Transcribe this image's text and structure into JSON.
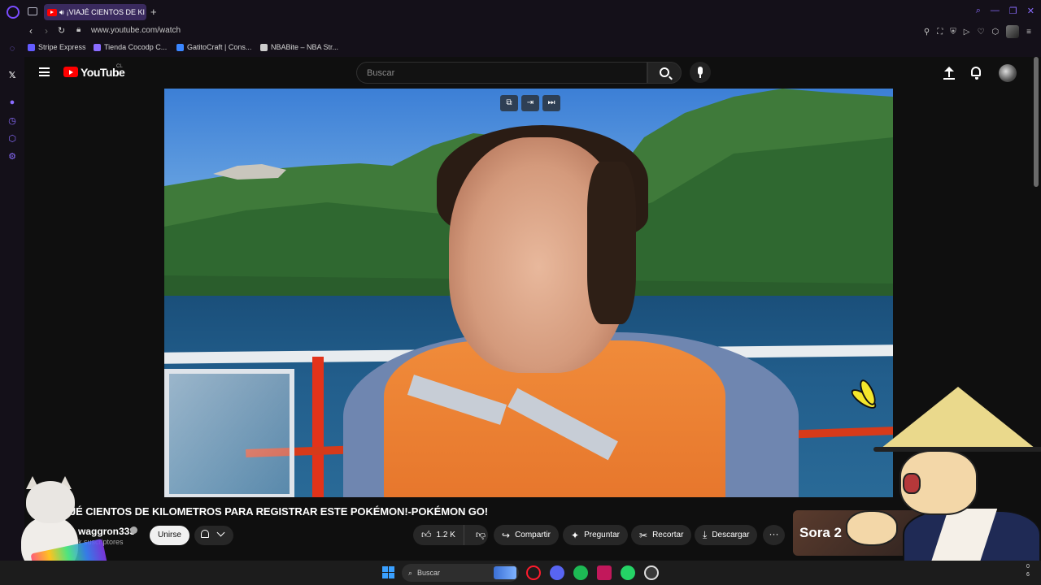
{
  "browser": {
    "tab_title": "¡VIAJÉ CIENTOS DE KI",
    "new_tab_symbol": "+",
    "url": "www.youtube.com/watch",
    "bookmarks": [
      {
        "label": "Stripe Express",
        "color": "#635bff"
      },
      {
        "label": "Tienda Cocodp C...",
        "color": "#8a6cff"
      },
      {
        "label": "GatitoCraft | Cons...",
        "color": "#3a86ff"
      },
      {
        "label": "NBABite – NBA Str...",
        "color": "#cccccc"
      }
    ],
    "accent_color": "#7a4cff"
  },
  "youtube": {
    "wordmark": "YouTube",
    "region": "CL",
    "search_placeholder": "Buscar",
    "video": {
      "title": "JÉ CIENTOS DE KILOMETROS PARA REGISTRAR ESTE POKÉMON!-POKÉMON GO!",
      "channel": "waggron333",
      "subscribers": "k suscriptores",
      "join_label": "Unirse",
      "likes": "1.2 K",
      "actions": {
        "share": "Compartir",
        "ask": "Preguntar",
        "clip": "Recortar",
        "download": "Descargar"
      },
      "more_symbol": "···"
    },
    "ad_card_text": "Sora 2"
  },
  "taskbar": {
    "search_label": "Buscar",
    "clock_line1": "0",
    "clock_line2": "6"
  }
}
